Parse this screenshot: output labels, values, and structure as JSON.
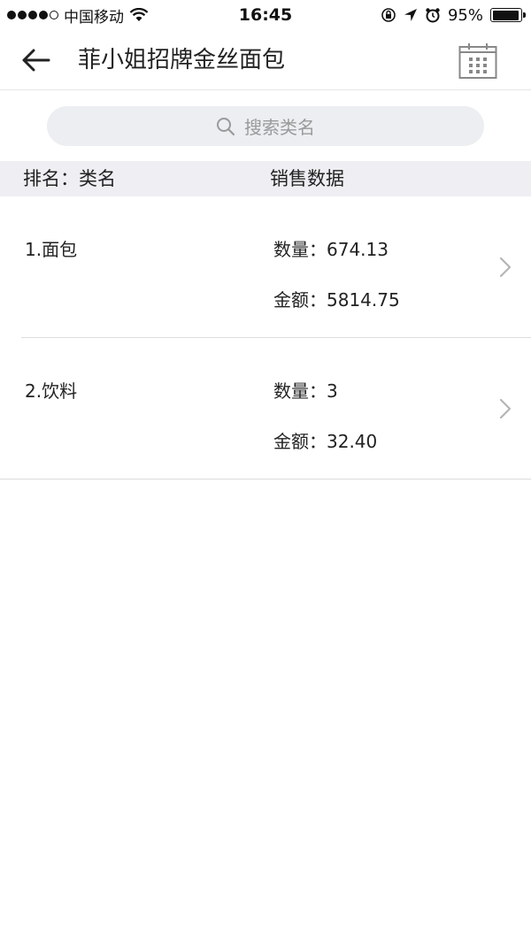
{
  "status_bar": {
    "carrier": "中国移动",
    "time": "16:45",
    "battery": "95%",
    "battery_level": 0.95
  },
  "nav": {
    "title": "菲小姐招牌金丝面包",
    "back_icon": "arrow-left-icon",
    "calendar_icon": "calendar-icon"
  },
  "search": {
    "placeholder": "搜索类名"
  },
  "table": {
    "headers": {
      "rank": "排名：类名",
      "sales": "销售数据"
    },
    "rows": [
      {
        "name": "1.面包",
        "qty": "数量：674.13",
        "amt": "金额：5814.75"
      },
      {
        "name": "2.饮料",
        "qty": "数量：3",
        "amt": "金额：32.40"
      }
    ]
  },
  "colors": {
    "header_bg": "#eeeef3",
    "search_bg": "#eceef1",
    "divider": "#dcdcdc"
  }
}
